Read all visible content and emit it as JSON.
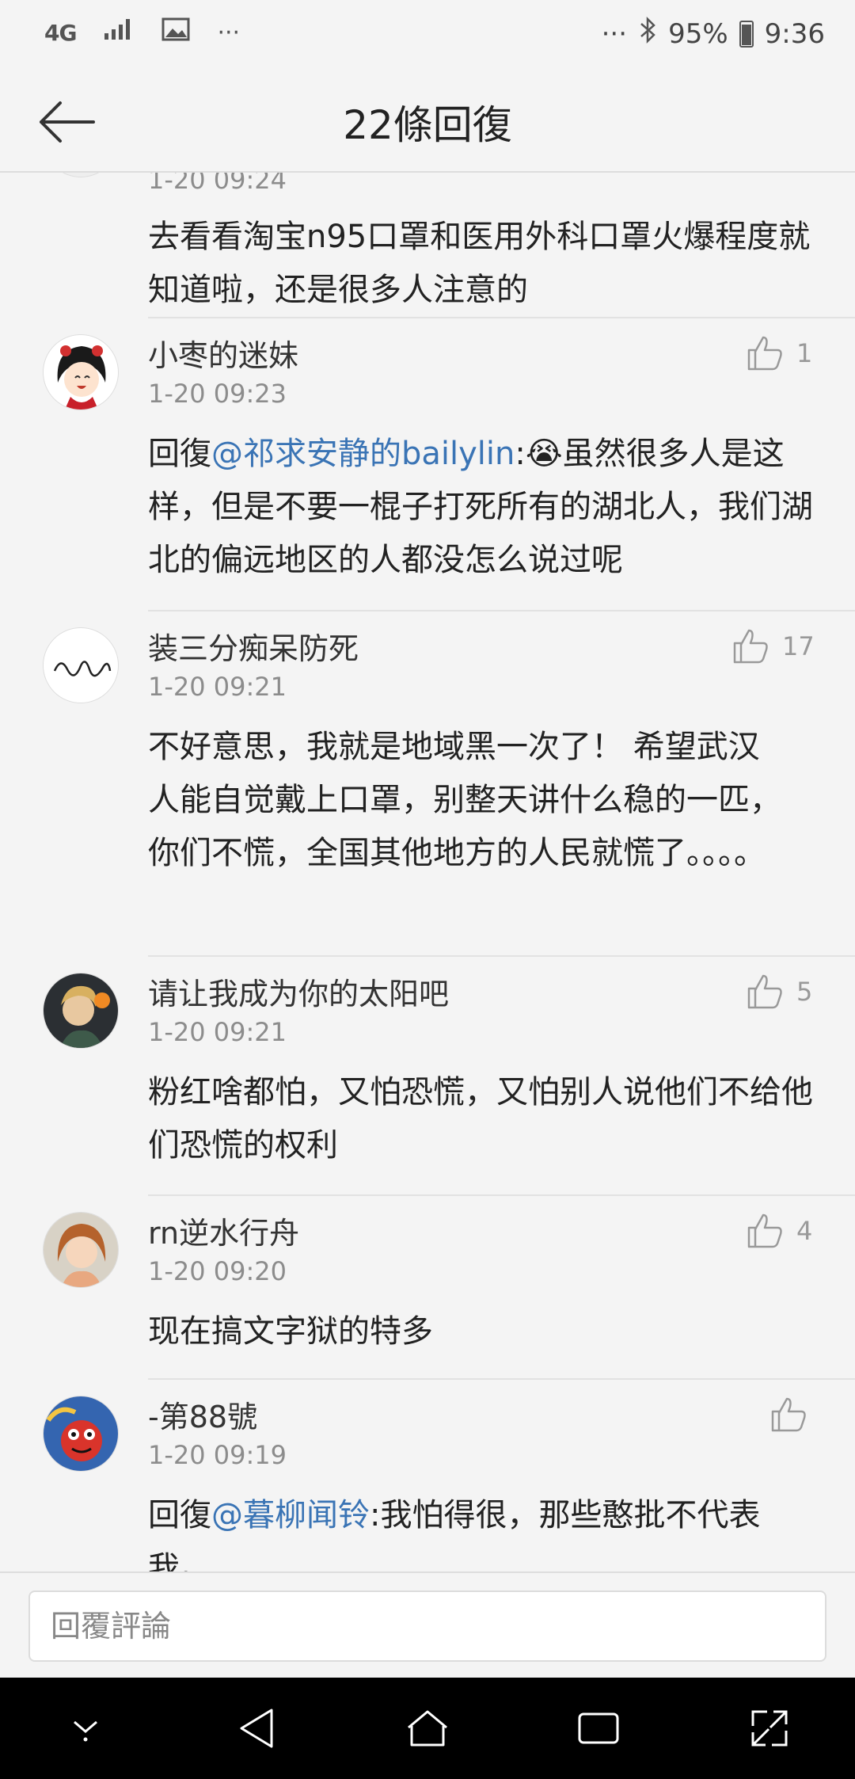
{
  "status_bar": {
    "network": "4G",
    "battery": "95%",
    "time": "9:36",
    "more_left": "···",
    "more_right": "···"
  },
  "app_bar": {
    "title": "22條回復"
  },
  "comments": [
    {
      "time": "1-20 09:24",
      "body": "去看看淘宝n95口罩和医用外科口罩火爆程度就知道啦，还是很多人注意的"
    },
    {
      "name": "小枣的迷妹",
      "time": "1-20 09:23",
      "likes": "1",
      "reply_prefix": "回復",
      "mention": "@祁求安静的bailylin",
      "body": ":😭虽然很多人是这样，但是不要一棍子打死所有的湖北人，我们湖北的偏远地区的人都没怎么说过呢"
    },
    {
      "name": "装三分痴呆防死",
      "time": "1-20 09:21",
      "likes": "17",
      "body": "不好意思，我就是地域黑一次了！ 希望武汉人能自觉戴上口罩，别整天讲什么稳的一匹，你们不慌，全国其他地方的人民就慌了。。。。"
    },
    {
      "name": "请让我成为你的太阳吧",
      "time": "1-20 09:21",
      "likes": "5",
      "body": "粉红啥都怕，又怕恐慌，又怕别人说他们不给他们恐慌的权利"
    },
    {
      "name": "rn逆水行舟",
      "time": "1-20 09:20",
      "likes": "4",
      "body": "现在搞文字狱的特多"
    },
    {
      "name": "-第88號",
      "time": "1-20 09:19",
      "likes": "",
      "reply_prefix": "回復",
      "mention": "@暮柳闻铃",
      "body": ":我怕得很，那些憨批不代表我。"
    }
  ],
  "reply_bar": {
    "placeholder": "回覆評論"
  },
  "colors": {
    "mention": "#3a74b5",
    "background": "#f4f4f4"
  }
}
